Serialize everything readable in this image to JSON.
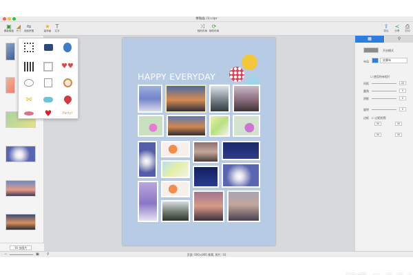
{
  "window": {
    "title": "拼贴画 (1).clpr"
  },
  "toolbar": {
    "left_buttons": [
      {
        "label": "模板模板",
        "icon": "template-icon",
        "color": "#3a9a3a"
      },
      {
        "label": "尺寸",
        "icon": "ratio-icon",
        "color": "#d08a1a"
      },
      {
        "label": "双面拼图",
        "icon": "merge-icon",
        "color": "#3a78c8"
      }
    ],
    "sticker_button": {
      "label": "装饰画",
      "icon": "sticker-icon"
    },
    "text_button": {
      "label": "文字",
      "icon": "text-icon"
    },
    "center_buttons": [
      {
        "label": "随机布局",
        "icon": "shuffle-icon"
      },
      {
        "label": "随机布局",
        "icon": "refresh-icon"
      }
    ],
    "right_buttons": [
      {
        "label": "导出",
        "icon": "export-icon"
      },
      {
        "label": "分享",
        "icon": "share-icon"
      },
      {
        "label": "打印",
        "icon": "print-icon"
      }
    ]
  },
  "sidebar": {
    "bottom_label": "16 张图片"
  },
  "page": {
    "headline": "HAPPY EVERYDAY"
  },
  "stickers_popover": {
    "items": [
      "qr-frame",
      "camera",
      "balloons",
      "qr-code",
      "frame",
      "sunglasses",
      "speech-bubble",
      "note",
      "coffee",
      "bow",
      "cloud",
      "strawberry",
      "lips",
      "heart",
      "party-text"
    ],
    "party_text": "Party!"
  },
  "right_panel": {
    "tabs": [
      "tab-layout",
      "tab-search"
    ],
    "mode_label": "开启模式",
    "layout_label": "布局",
    "layout_value": "实景布",
    "checkbox_label": "使用所有相片",
    "sliders": [
      {
        "label": "间距",
        "value": "20"
      },
      {
        "label": "圆角",
        "value": "0"
      },
      {
        "label": "阴影",
        "value": "0"
      },
      {
        "label": "旋转",
        "value": "0"
      }
    ],
    "margin_label": "边框",
    "margin_checkbox": "边距相等",
    "margins": [
      "30",
      "30",
      "30",
      "30"
    ]
  },
  "status": {
    "text": "页面: 600×800 像素, 照片: 16"
  },
  "watermark": "知乎 @点点小星光"
}
